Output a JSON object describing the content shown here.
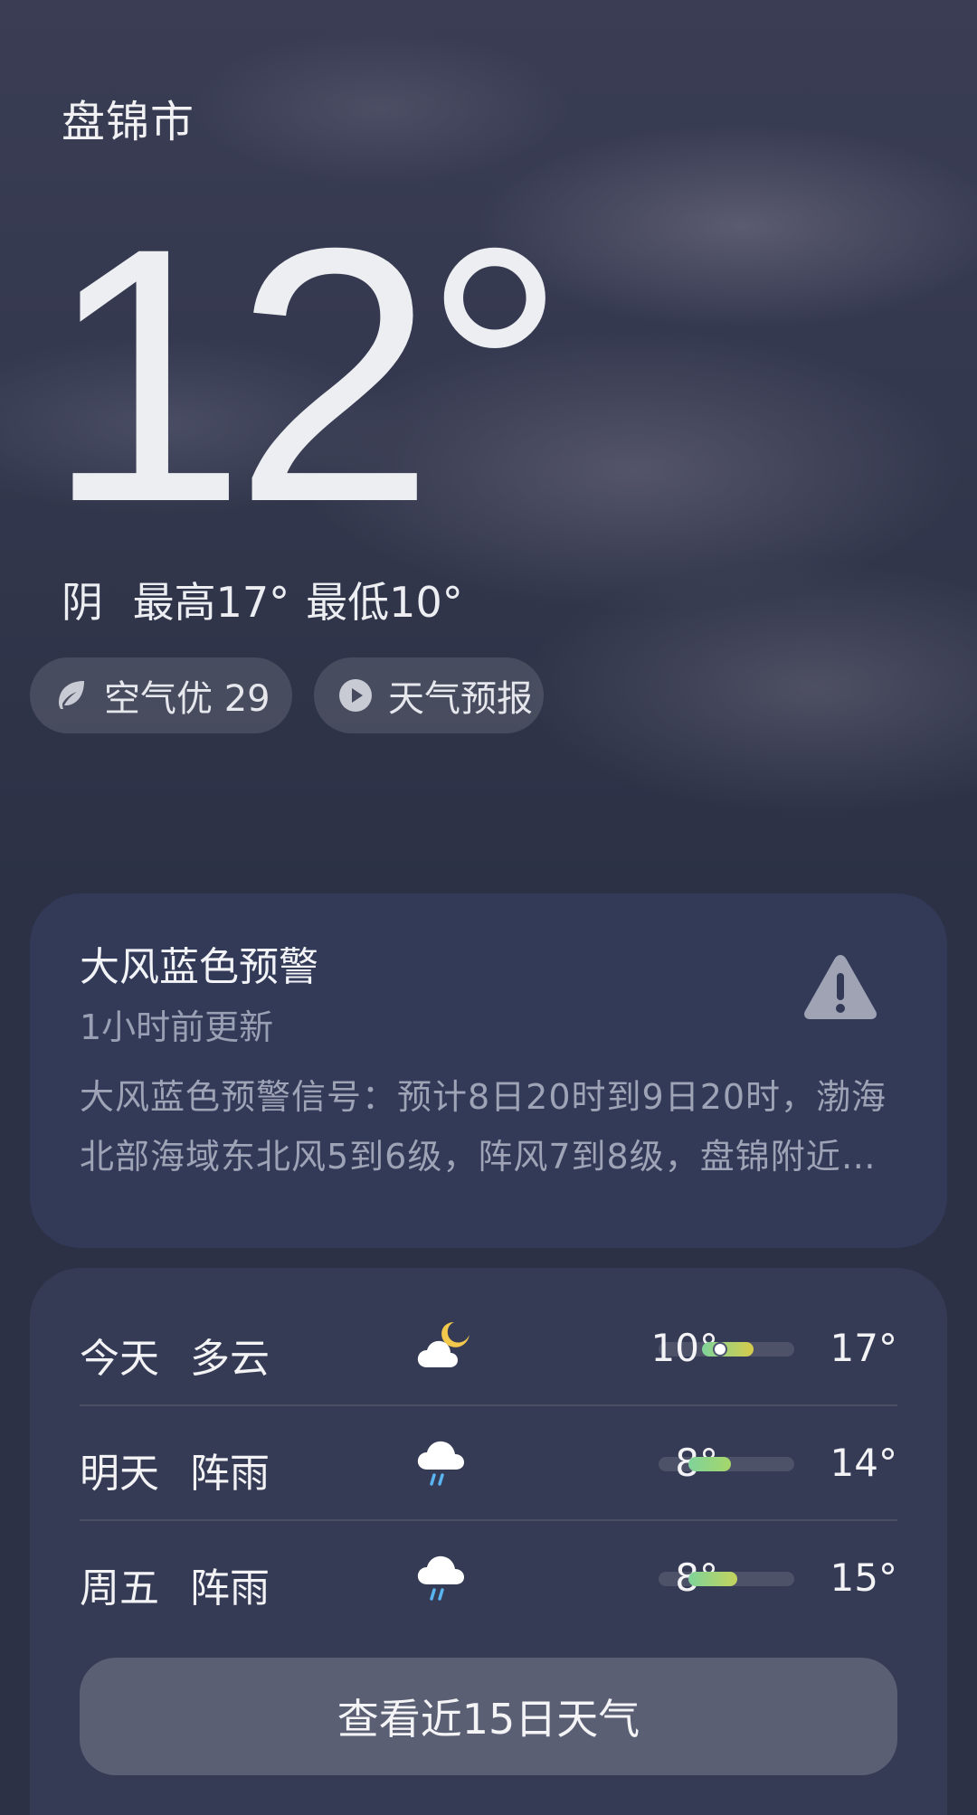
{
  "location": {
    "city": "盘锦市"
  },
  "current": {
    "temperature": "12°",
    "condition": "阴",
    "high": "最高17°",
    "low": "最低10°"
  },
  "pills": {
    "air_quality": "空气优 29",
    "forecast_video": "天气预报"
  },
  "alert": {
    "title": "大风蓝色预警",
    "updated": "1小时前更新",
    "body": "大风蓝色预警信号：预计8日20时到9日20时，渤海北部海域东北风5到6级，阵风7到8级，盘锦附近…",
    "icon": "warning-triangle-icon"
  },
  "forecast": {
    "days": [
      {
        "day": "今天",
        "condition": "多云",
        "icon": "cloud-moon-icon",
        "low": "10°",
        "high": "17°",
        "bar_start": 0.32,
        "bar_end": 0.7,
        "current_pos": 0.45,
        "bar_colors": [
          "#7fd39a",
          "#d6cc4a"
        ]
      },
      {
        "day": "明天",
        "condition": "阵雨",
        "icon": "cloud-rain-icon",
        "low": "8°",
        "high": "14°",
        "bar_start": 0.22,
        "bar_end": 0.53,
        "bar_colors": [
          "#7fd39a",
          "#a6d66a"
        ]
      },
      {
        "day": "周五",
        "condition": "阵雨",
        "icon": "cloud-rain-icon",
        "low": "8°",
        "high": "15°",
        "bar_start": 0.22,
        "bar_end": 0.58,
        "bar_colors": [
          "#7fd39a",
          "#c3d35c"
        ]
      }
    ],
    "more_button": "查看近15日天气"
  },
  "colors": {
    "background": "#2c3146",
    "alert_card": "#333a58",
    "forecast_card": "#363b55",
    "button": "#5a5f73"
  }
}
